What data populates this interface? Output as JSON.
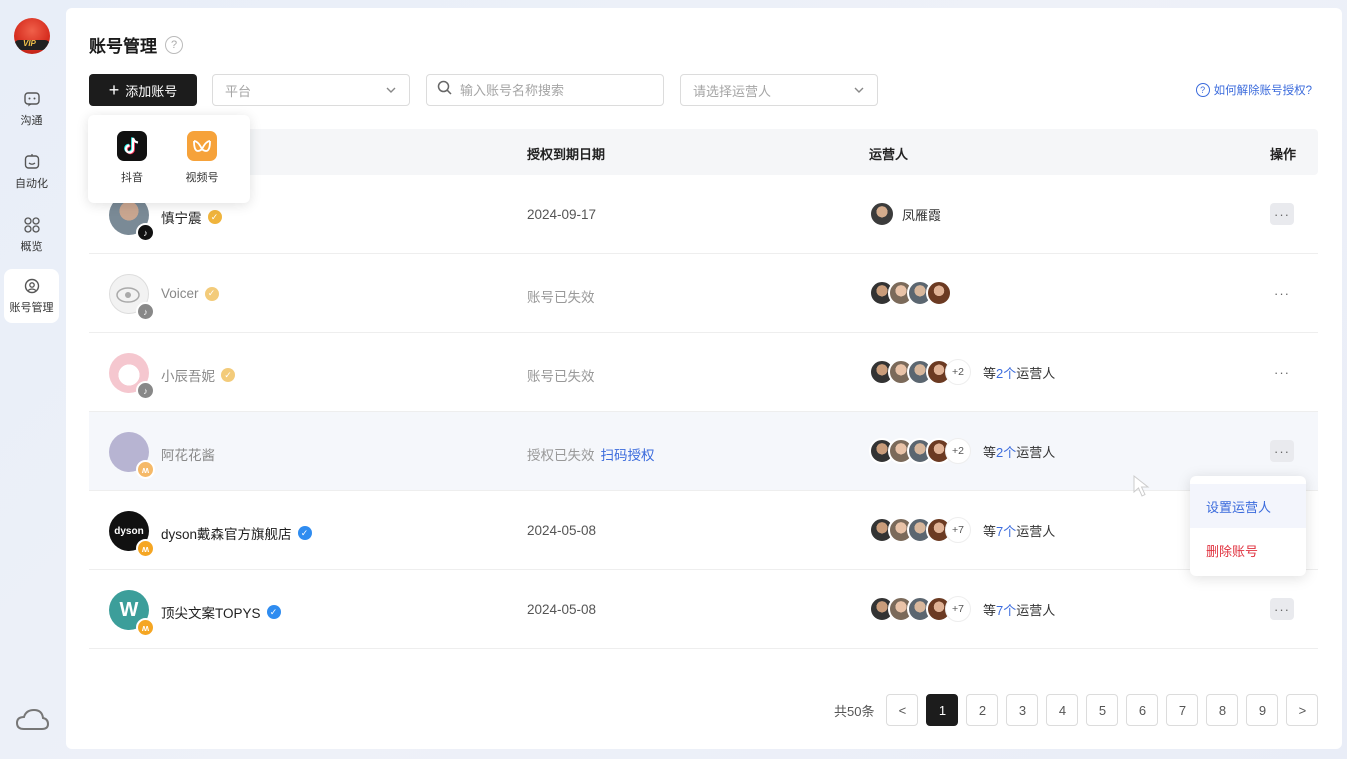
{
  "sidebar": {
    "logo_text": "VIP",
    "items": [
      {
        "label": "沟通",
        "icon": "chat-icon"
      },
      {
        "label": "自动化",
        "icon": "robot-icon"
      },
      {
        "label": "概览",
        "icon": "grid-icon"
      },
      {
        "label": "账号管理",
        "icon": "account-icon"
      }
    ],
    "active_index": 3
  },
  "header": {
    "title": "账号管理",
    "help": "?"
  },
  "toolbar": {
    "add_label": "添加账号",
    "platform_placeholder": "平台",
    "search_placeholder": "输入账号名称搜索",
    "operator_placeholder": "请选择运营人",
    "help_link": "如何解除账号授权?"
  },
  "platform_popup": {
    "options": [
      {
        "label": "抖音",
        "icon": "douyin-icon"
      },
      {
        "label": "视频号",
        "icon": "channels-icon"
      }
    ]
  },
  "table": {
    "columns": [
      "授权到期日期",
      "运营人",
      "操作"
    ],
    "rows": [
      {
        "name": "慎宁震",
        "expire": "2024-09-17",
        "operator_name": "凤雁霞",
        "platform": "douyin"
      },
      {
        "name": "Voicer",
        "expire": "账号已失效",
        "platform": "douyin"
      },
      {
        "name": "小辰吾妮",
        "expire": "账号已失效",
        "more": "+2",
        "pre": "等",
        "count": "2个",
        "post": "运营人",
        "platform": "douyin"
      },
      {
        "name": "阿花花酱",
        "expire": "授权已失效",
        "action_link": "扫码授权",
        "more": "+2",
        "pre": "等",
        "count": "2个",
        "post": "运营人",
        "platform": "channels"
      },
      {
        "name": "dyson戴森官方旗舰店",
        "avatar_text": "dyson",
        "expire": "2024-05-08",
        "more": "+7",
        "pre": "等",
        "count": "7个",
        "post": "运营人",
        "platform": "channels"
      },
      {
        "name": "顶尖文案TOPYS",
        "avatar_text": "W",
        "expire": "2024-05-08",
        "more": "+7",
        "pre": "等",
        "count": "7个",
        "post": "运营人",
        "platform": "channels"
      }
    ]
  },
  "action_menu": {
    "items": [
      "设置运营人",
      "删除账号"
    ]
  },
  "pagination": {
    "total": "共50条",
    "pages": [
      "1",
      "2",
      "3",
      "4",
      "5",
      "6",
      "7",
      "8",
      "9"
    ],
    "current": "1",
    "prev": "<",
    "next": ">"
  },
  "colors": {
    "accent": "#3b6bdc",
    "danger": "#e0323f",
    "dark": "#1c1c1c",
    "verified_gold": "#f0b43c",
    "verified_blue": "#2f8cf0"
  }
}
